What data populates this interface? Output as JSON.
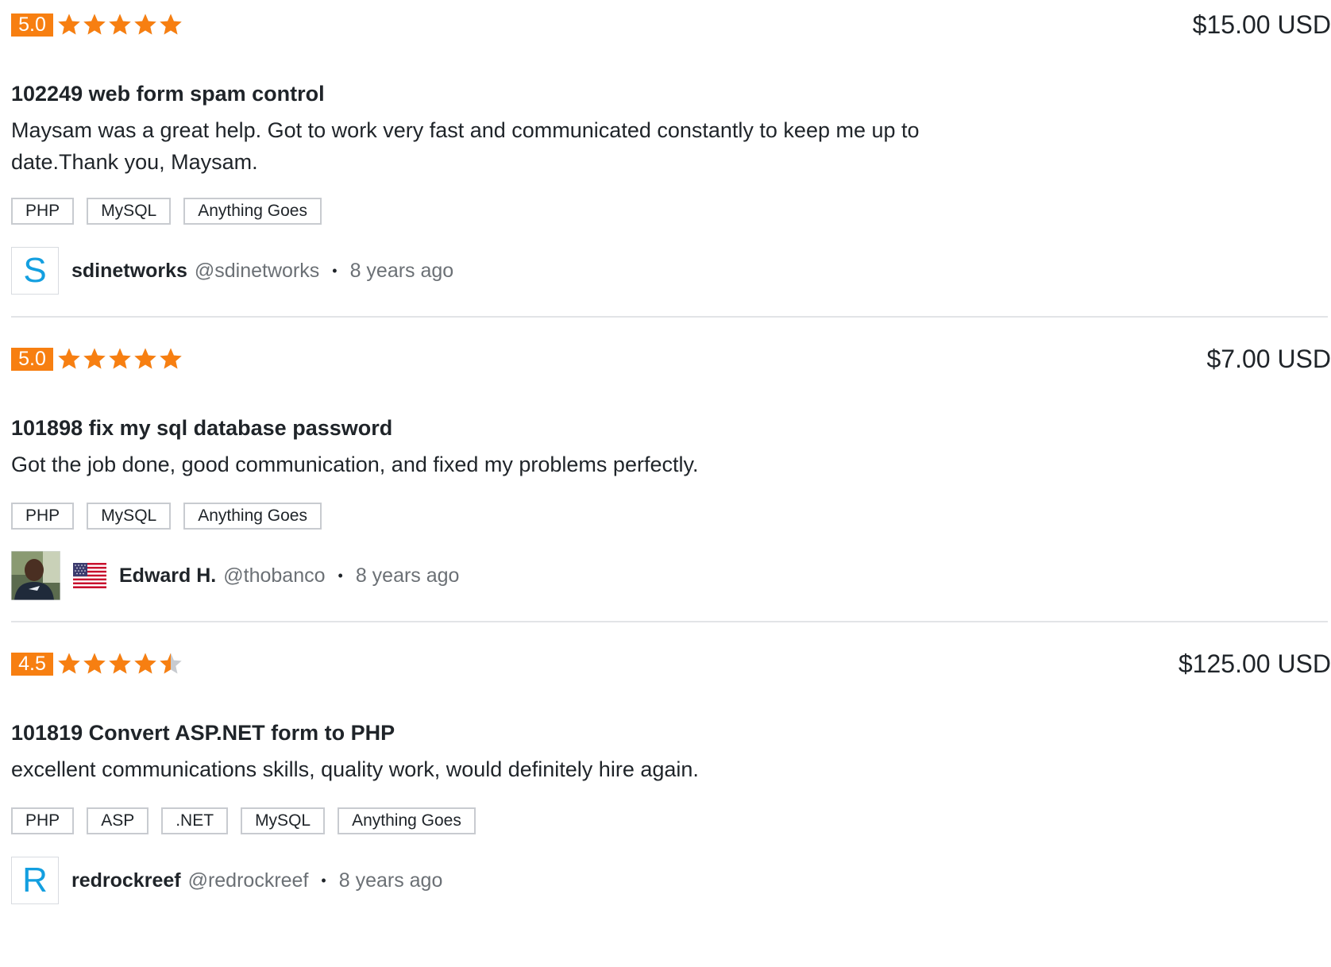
{
  "colors": {
    "accent": "#f77f11",
    "star_empty": "#c8cbd0",
    "avatar_letter": "#139fe0",
    "muted_text": "#6b7075"
  },
  "reviews": [
    {
      "rating": "5.0",
      "stars": 5,
      "price": "$15.00 USD",
      "title": "102249 web form spam control",
      "comment": "Maysam was a great help. Got to work very fast and communicated constantly to keep me up to date.Thank you, Maysam.",
      "tags": [
        "PHP",
        "MySQL",
        "Anything Goes"
      ],
      "avatar_letter": "S",
      "user_name": "sdinetworks",
      "user_handle": "@sdinetworks",
      "separator": "•",
      "time": "8 years ago"
    },
    {
      "rating": "5.0",
      "stars": 5,
      "price": "$7.00 USD",
      "title": "101898 fix my sql database password",
      "comment": "Got the job done, good communication, and fixed my problems perfectly.",
      "tags": [
        "PHP",
        "MySQL",
        "Anything Goes"
      ],
      "avatar_icon": "user-photo",
      "flag_icon": "us-flag-icon",
      "user_name": "Edward H.",
      "user_handle": "@thobanco",
      "separator": "•",
      "time": "8 years ago"
    },
    {
      "rating": "4.5",
      "stars": 4.5,
      "price": "$125.00 USD",
      "title": "101819 Convert ASP.NET form to PHP",
      "comment": "excellent communications skills, quality work, would definitely hire again.",
      "tags": [
        "PHP",
        "ASP",
        ".NET",
        "MySQL",
        "Anything Goes"
      ],
      "avatar_letter": "R",
      "user_name": "redrockreef",
      "user_handle": "@redrockreef",
      "separator": "•",
      "time": "8 years ago"
    }
  ]
}
